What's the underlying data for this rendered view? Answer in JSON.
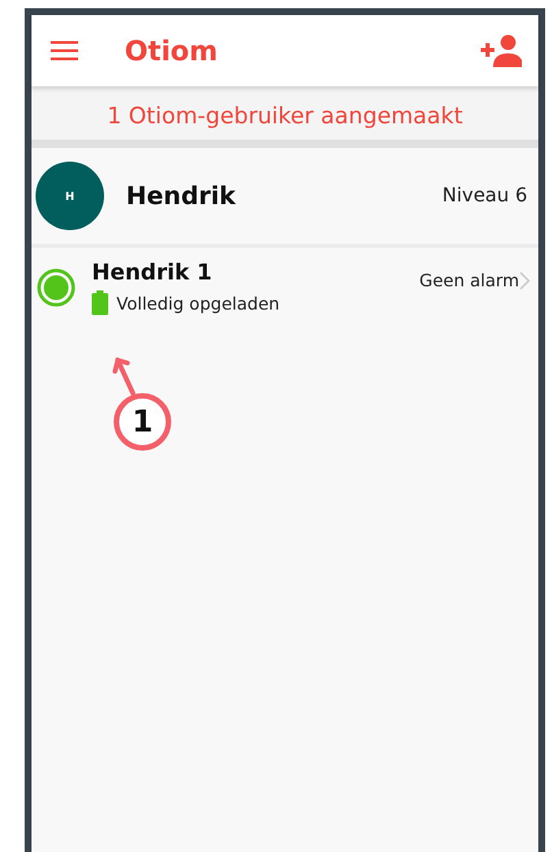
{
  "app_bar": {
    "title": "Otiom"
  },
  "banner": "1 Otiom-gebruiker aangemaakt",
  "user": {
    "initial": "H",
    "name": "Hendrik",
    "level": "Niveau 6"
  },
  "devices": [
    {
      "name": "Hendrik 1",
      "battery": "Volledig opgeladen",
      "alarm": "Geen alarm",
      "color": "#52c41a"
    }
  ],
  "callout": {
    "number": "1"
  }
}
